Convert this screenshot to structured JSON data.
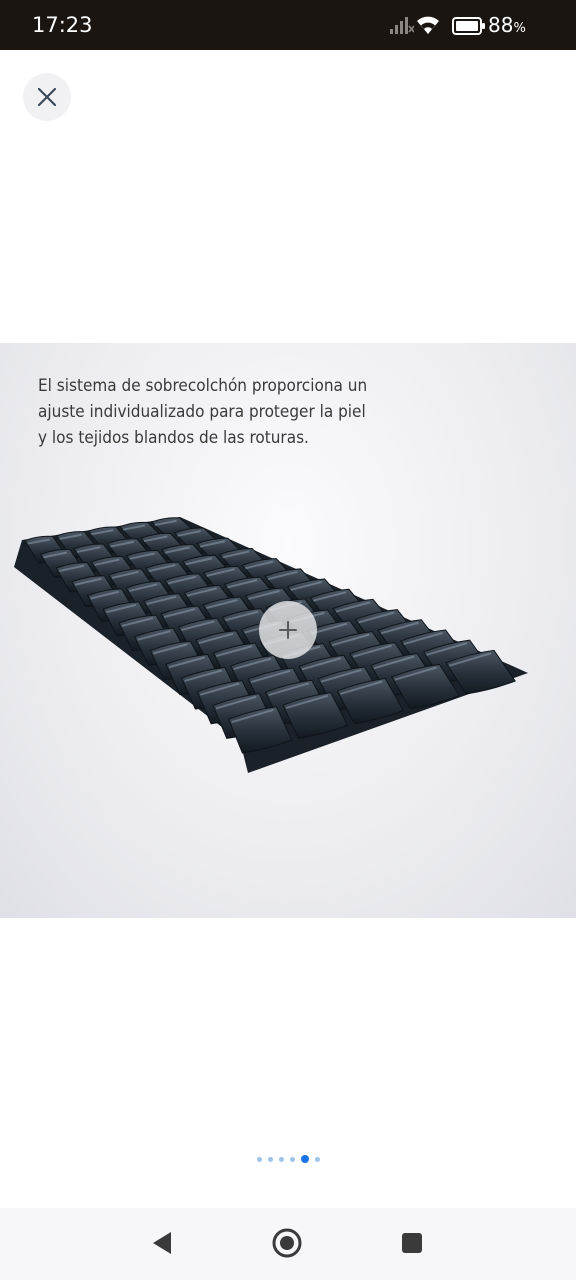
{
  "status_bar": {
    "time": "17:23",
    "battery_percent": "88",
    "battery_unit": "%",
    "icons": [
      "signal-icon",
      "wifi-icon",
      "battery-icon"
    ]
  },
  "viewer": {
    "close_icon": "close-icon",
    "caption_lines": [
      "El sistema de sobrecolchón proporciona un",
      "ajuste individualizado para proteger la piel",
      "y los tejidos blandos de las roturas."
    ],
    "zoom_icon": "plus-icon",
    "pages": {
      "count": 6,
      "current": 5
    }
  },
  "nav_bar": {
    "icons": [
      "back-icon",
      "home-icon",
      "recents-icon"
    ]
  },
  "colors": {
    "status_bar_bg": "#1a1511",
    "active_dot": "#1a73e8",
    "inactive_dot": "#9fc4ea",
    "nav_bar_bg": "#f7f7f9"
  }
}
